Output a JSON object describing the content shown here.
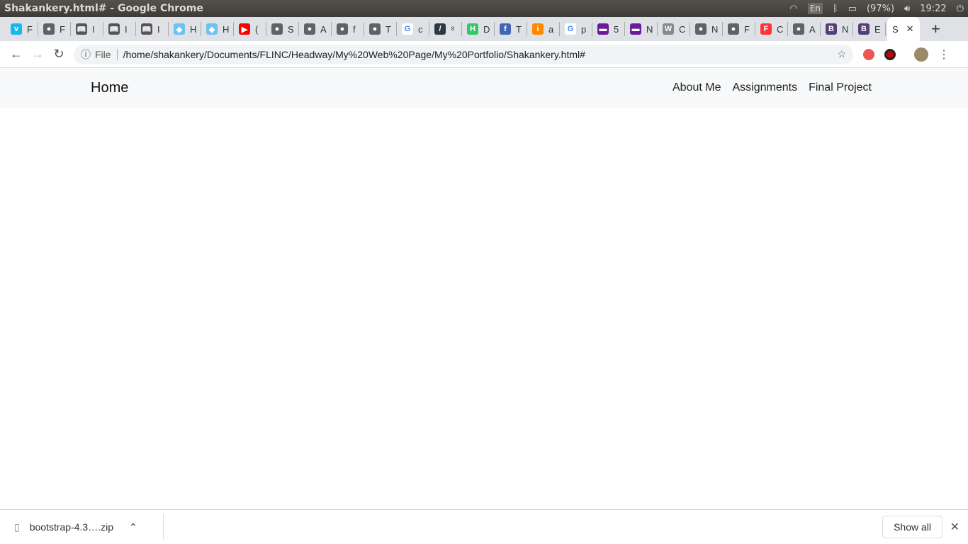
{
  "system": {
    "window_title": "Shakankery.html# - Google Chrome",
    "lang": "En",
    "battery": "(97%)",
    "time": "19:22"
  },
  "tabs": [
    {
      "t": "F",
      "icon": "vimeo",
      "c": "#1ab7ea",
      "g": "v"
    },
    {
      "t": "F",
      "icon": "globe",
      "c": "#5f6368",
      "g": "●"
    },
    {
      "t": "I",
      "icon": "book",
      "c": "#555",
      "g": "📖"
    },
    {
      "t": "I",
      "icon": "book",
      "c": "#555",
      "g": "📖"
    },
    {
      "t": "I",
      "icon": "book",
      "c": "#555",
      "g": "📖"
    },
    {
      "t": "H",
      "icon": "bird",
      "c": "#6cc3f0",
      "g": "◆"
    },
    {
      "t": "H",
      "icon": "bird",
      "c": "#6cc3f0",
      "g": "◆"
    },
    {
      "t": "(",
      "icon": "youtube",
      "c": "#f00",
      "g": "▶"
    },
    {
      "t": "S",
      "icon": "globe",
      "c": "#5f6368",
      "g": "●"
    },
    {
      "t": "A",
      "icon": "globe",
      "c": "#5f6368",
      "g": "●"
    },
    {
      "t": "f",
      "icon": "globe",
      "c": "#5f6368",
      "g": "●"
    },
    {
      "t": "T",
      "icon": "globe",
      "c": "#5f6368",
      "g": "●"
    },
    {
      "t": "c",
      "icon": "google",
      "c": "#fff",
      "g": "G"
    },
    {
      "t": "⁸",
      "icon": "feather",
      "c": "#2b3a42",
      "g": "/"
    },
    {
      "t": "D",
      "icon": "hackerrank",
      "c": "#2ec866",
      "g": "H"
    },
    {
      "t": "T",
      "icon": "facebook",
      "c": "#4267b2",
      "g": "f"
    },
    {
      "t": "a",
      "icon": "info",
      "c": "#f80",
      "g": "i"
    },
    {
      "t": "p",
      "icon": "google",
      "c": "#fff",
      "g": "G"
    },
    {
      "t": "5",
      "icon": "colorlib",
      "c": "#6a1b9a",
      "g": "▬"
    },
    {
      "t": "N",
      "icon": "colorlib",
      "c": "#6a1b9a",
      "g": "▬"
    },
    {
      "t": "C",
      "icon": "wordpress",
      "c": "#888",
      "g": "W"
    },
    {
      "t": "N",
      "icon": "globe",
      "c": "#5f6368",
      "g": "●"
    },
    {
      "t": "F",
      "icon": "globe",
      "c": "#5f6368",
      "g": "●"
    },
    {
      "t": "C",
      "icon": "f-red",
      "c": "#f33",
      "g": "F"
    },
    {
      "t": "A",
      "icon": "globe",
      "c": "#5f6368",
      "g": "●"
    },
    {
      "t": "N",
      "icon": "bootstrap",
      "c": "#563d7c",
      "g": "B"
    },
    {
      "t": "E",
      "icon": "bootstrap",
      "c": "#563d7c",
      "g": "B"
    }
  ],
  "active_tab": {
    "title": "S",
    "close": "✕"
  },
  "new_tab": "+",
  "address": {
    "scheme_label": "File",
    "url": "/home/shakankery/Documents/FLINC/Headway/My%20Web%20Page/My%20Portfolio/Shakankery.html#"
  },
  "page": {
    "brand": "Home",
    "nav": [
      "About Me",
      "Assignments",
      "Final Project"
    ]
  },
  "downloads": {
    "file": "bootstrap-4.3….zip",
    "show_all": "Show all"
  }
}
